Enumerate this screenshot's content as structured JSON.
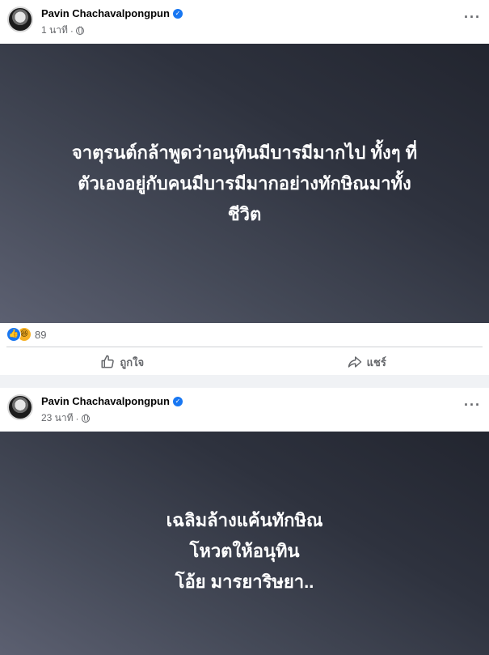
{
  "posts": [
    {
      "author": "Pavin Chachavalpongpun",
      "time": "1 นาที",
      "separator": "·",
      "icons": {
        "verified": "verified-badge-icon",
        "audience": "globe-icon",
        "menu": "more-options-icon"
      },
      "text_lines": [
        "จาตุรนต์กล้าพูดว่าอนุทินมีบารมีมากไป ทั้งๆ ที่",
        "ตัวเองอยู่กับคนมีบารมีมากอย่างทักษิณมาทั้ง",
        "ชีวิต"
      ],
      "reactions": {
        "types": [
          "like",
          "haha"
        ],
        "count": "89"
      },
      "actions": {
        "like_label": "ถูกใจ",
        "share_label": "แชร์"
      }
    },
    {
      "author": "Pavin Chachavalpongpun",
      "time": "23 นาที",
      "separator": "·",
      "icons": {
        "verified": "verified-badge-icon",
        "audience": "globe-icon",
        "menu": "more-options-icon"
      },
      "text_lines": [
        "เฉลิมล้างแค้นทักษิณ",
        "โหวตให้อนุทิน",
        "โอ้ย มารยาริษยา.."
      ]
    }
  ],
  "colors": {
    "accent": "#1877f2",
    "post_background_start": "#5c6071",
    "post_background_end": "#22252f",
    "secondary_text": "#65676b"
  }
}
